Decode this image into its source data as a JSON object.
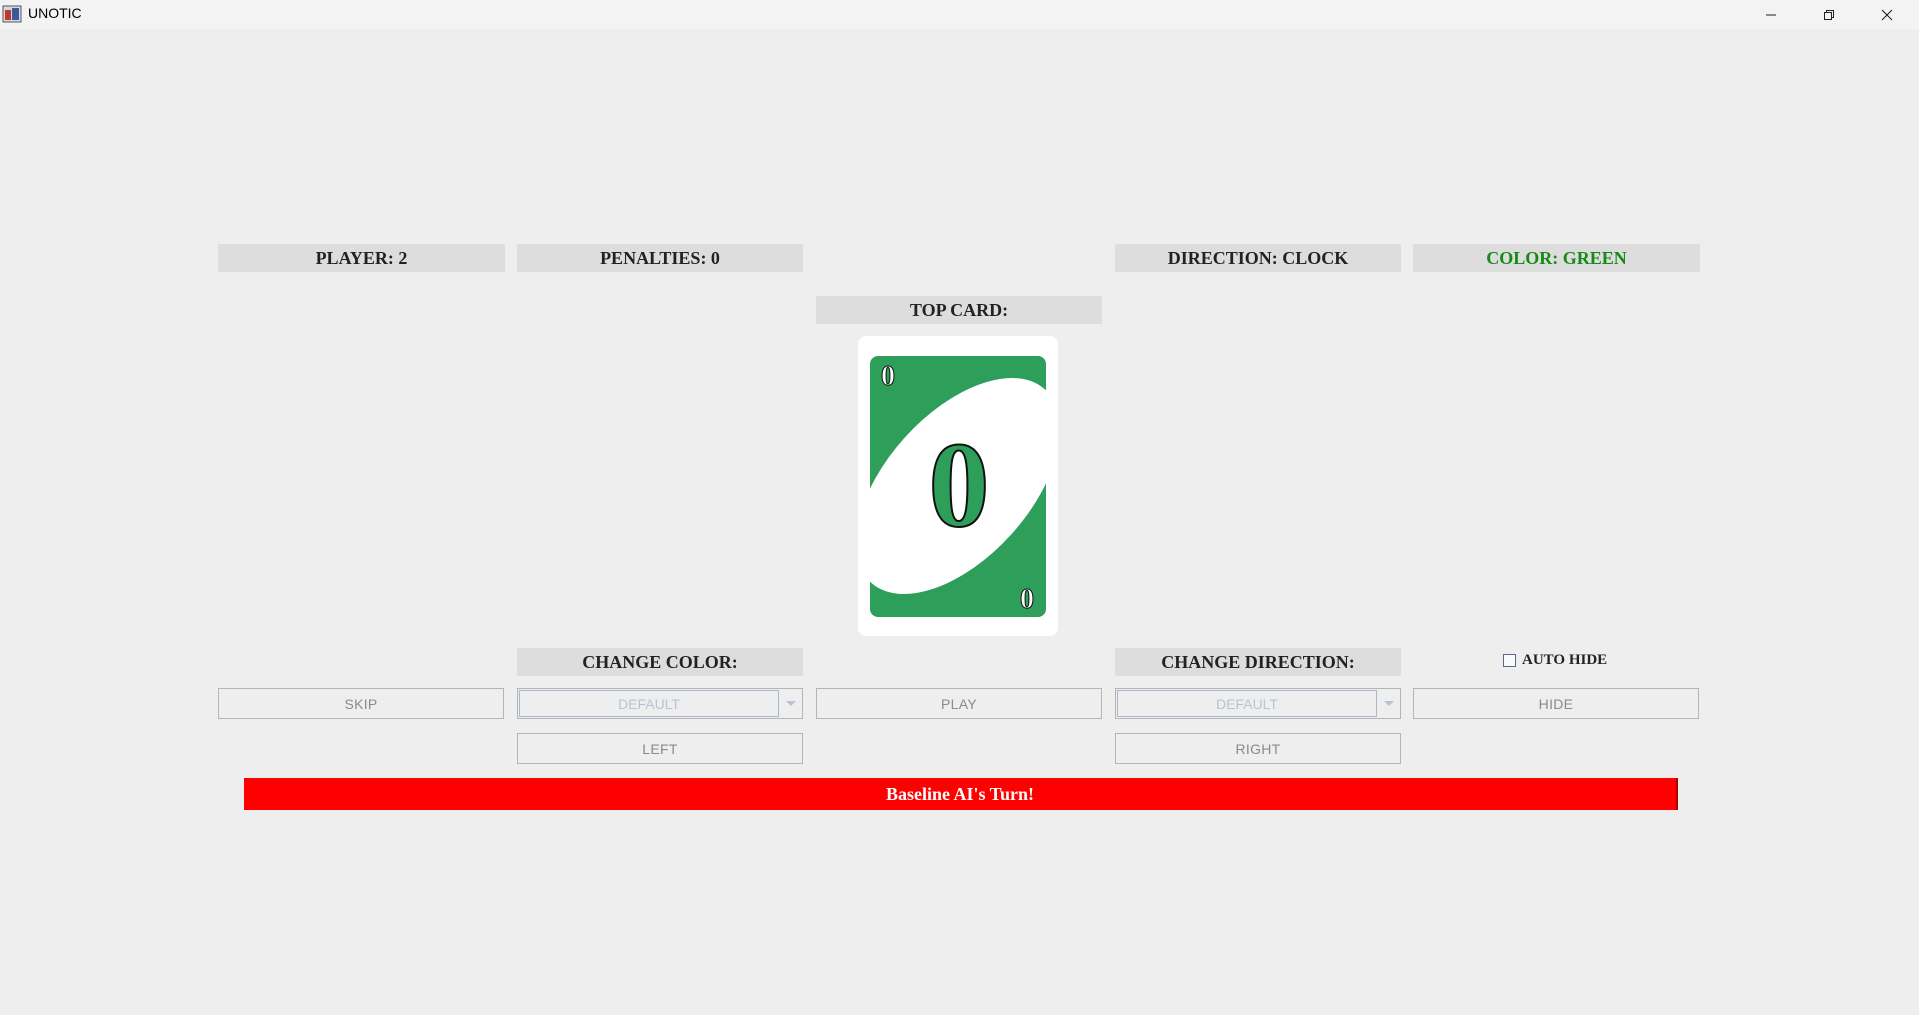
{
  "window": {
    "title": "UNOTIC",
    "icon": "app-icon",
    "controls": [
      "minimize-icon",
      "restore-icon",
      "close-icon"
    ]
  },
  "info": {
    "player": "PLAYER: 2",
    "penalties": "PENALTIES: 0",
    "direction": "DIRECTION: CLOCK",
    "color": "COLOR: GREEN",
    "color_value": "#168a16"
  },
  "top_card": {
    "label": "TOP CARD:",
    "value": "0",
    "color": "#2e9e5b"
  },
  "controls": {
    "change_color_label": "CHANGE COLOR:",
    "change_direction_label": "CHANGE DIRECTION:",
    "auto_hide_label": "AUTO HIDE",
    "auto_hide_checked": false,
    "skip": "SKIP",
    "color_select": "DEFAULT",
    "play": "PLAY",
    "direction_select": "DEFAULT",
    "hide": "HIDE",
    "left": "LEFT",
    "right": "RIGHT"
  },
  "status": {
    "message": "Baseline AI's Turn!",
    "color": "#ff0000"
  }
}
